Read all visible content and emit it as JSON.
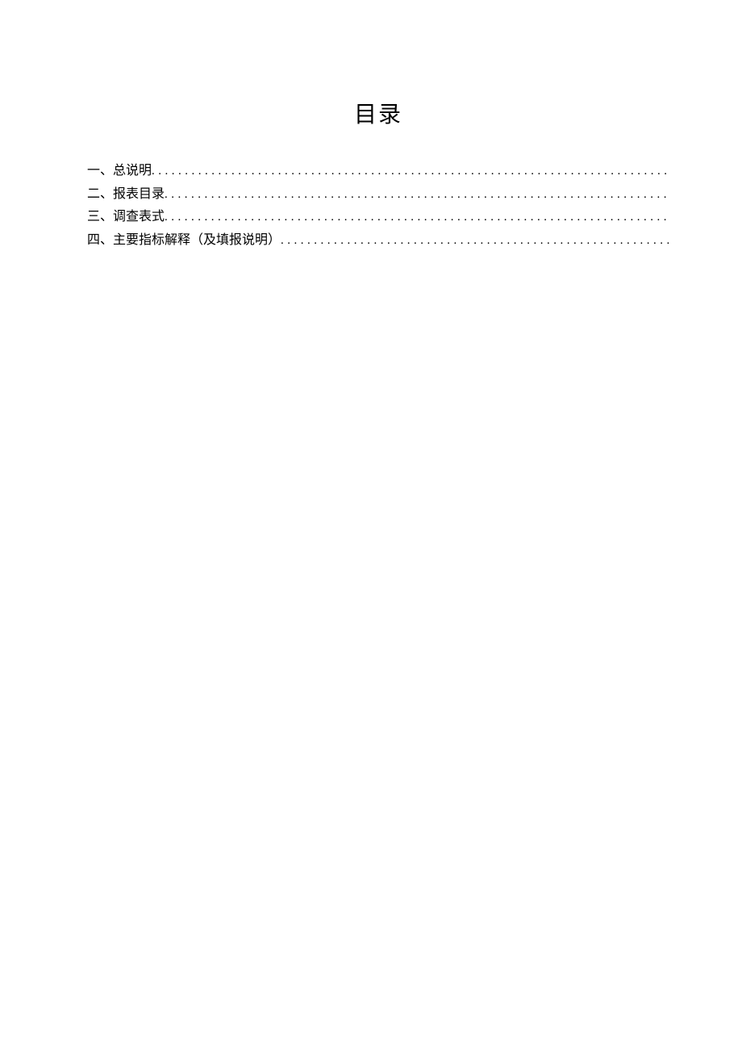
{
  "title": "目录",
  "toc": [
    {
      "label": "一、总说明"
    },
    {
      "label": "二、报表目录"
    },
    {
      "label": "三、调查表式"
    },
    {
      "label": "四、主要指标解释（及填报说明）"
    }
  ]
}
